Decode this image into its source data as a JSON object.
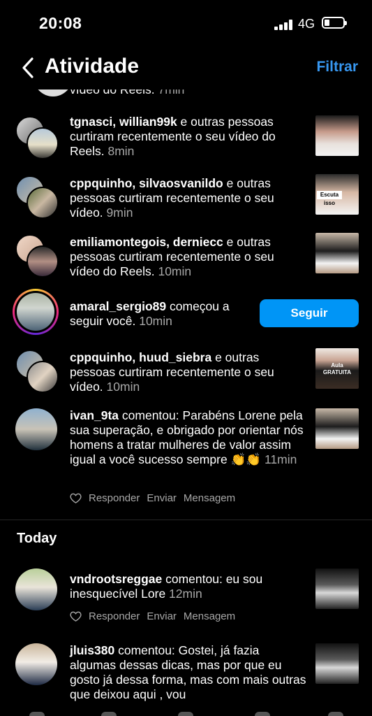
{
  "status": {
    "time": "20:08",
    "network": "4G"
  },
  "header": {
    "title": "Atividade",
    "filter": "Filtrar"
  },
  "partial_item": {
    "text": "vídeo do Reels.",
    "time": "7min"
  },
  "items": [
    {
      "users": "tgnasci, willian99k",
      "text": " e outras pessoas curtiram recentemente o seu vídeo do Reels.",
      "time": " 8min"
    },
    {
      "users": "cppquinho, silvaosvanildo",
      "text": " e outras pessoas curtiram recentemente o seu vídeo.",
      "time": " 9min",
      "thumb_caption": "Escuta isso"
    },
    {
      "users": "emiliamontegois, derniecc",
      "text": " e outras pessoas curtiram recentemente o seu vídeo do Reels.",
      "time": " 10min"
    },
    {
      "user": "amaral_sergio89",
      "text": " começou a seguir você.",
      "time": " 10min",
      "button": "Seguir"
    },
    {
      "users": "cppquinho, huud_siebra",
      "text": " e outras pessoas curtiram recentemente o seu vídeo.",
      "time": " 10min",
      "thumb_caption": "Aula GRATUITA"
    },
    {
      "user": "ivan_9ta",
      "text": " comentou: Parabéns Lorene pela sua superação, e obrigado por orientar nós homens a tratar mulheres de valor assim igual a você sucesso sempre 👏👏",
      "time": " 11min"
    }
  ],
  "comment_actions": {
    "reply": "Responder",
    "send": "Enviar",
    "message": "Mensagem"
  },
  "today": {
    "label": "Today",
    "items": [
      {
        "user": "vndrootsreggae",
        "text": " comentou: eu sou inesquecível Lore",
        "time": " 12min"
      },
      {
        "user": "jluis380",
        "text": " comentou: Gostei, já fazia algumas dessas dicas, mas por que eu gosto já dessa forma, mas com mais outras que deixou aqui , vou",
        "time": ""
      }
    ]
  },
  "colors": {
    "accent": "#3797f0",
    "follow_button": "#0095f6",
    "secondary_text": "#a8a8a8"
  }
}
